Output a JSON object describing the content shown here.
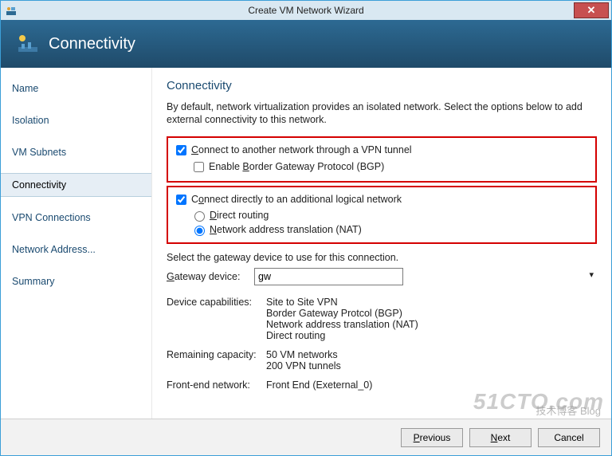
{
  "window": {
    "title": "Create VM Network Wizard"
  },
  "header": {
    "title": "Connectivity"
  },
  "sidebar": {
    "items": [
      {
        "label": "Name"
      },
      {
        "label": "Isolation"
      },
      {
        "label": "VM Subnets"
      },
      {
        "label": "Connectivity",
        "selected": true
      },
      {
        "label": "VPN Connections"
      },
      {
        "label": "Network Address..."
      },
      {
        "label": "Summary"
      }
    ]
  },
  "page": {
    "title": "Connectivity",
    "intro": "By default, network virtualization provides an isolated network. Select the options below to add external connectivity to this network.",
    "opt_vpn": {
      "label_pre": "",
      "label_u": "C",
      "label_post": "onnect to another network through a VPN tunnel",
      "checked": true
    },
    "opt_bgp": {
      "label_pre": "Enable ",
      "label_u": "B",
      "label_post": "order Gateway Protocol (BGP)",
      "checked": false
    },
    "opt_direct": {
      "label_pre": "C",
      "label_u": "o",
      "label_post": "nnect directly to an additional logical network",
      "checked": true
    },
    "opt_route": {
      "label_pre": "",
      "label_u": "D",
      "label_post": "irect routing",
      "selected": false
    },
    "opt_nat": {
      "label_pre": "",
      "label_u": "N",
      "label_post": "etwork address translation (NAT)",
      "selected": true
    },
    "select_note": "Select the gateway device to use for this connection.",
    "gateway_label_pre": "",
    "gateway_label_u": "G",
    "gateway_label_post": "ateway device:",
    "gateway_value": "gw",
    "caps_label": "Device capabilities:",
    "caps": [
      "Site to Site VPN",
      "Border Gateway Protcol (BGP)",
      "Network address translation (NAT)",
      "Direct routing"
    ],
    "remain_label": "Remaining capacity:",
    "remain": [
      "50 VM networks",
      "200 VPN tunnels"
    ],
    "front_label": "Front-end network:",
    "front_value": "Front End (Exeternal_0)"
  },
  "footer": {
    "previous_pre": "",
    "previous_u": "P",
    "previous_post": "revious",
    "next_pre": "",
    "next_u": "N",
    "next_post": "ext",
    "cancel": "Cancel"
  },
  "watermark": "51CTO.com",
  "watermark2": "技术博客   Blog"
}
